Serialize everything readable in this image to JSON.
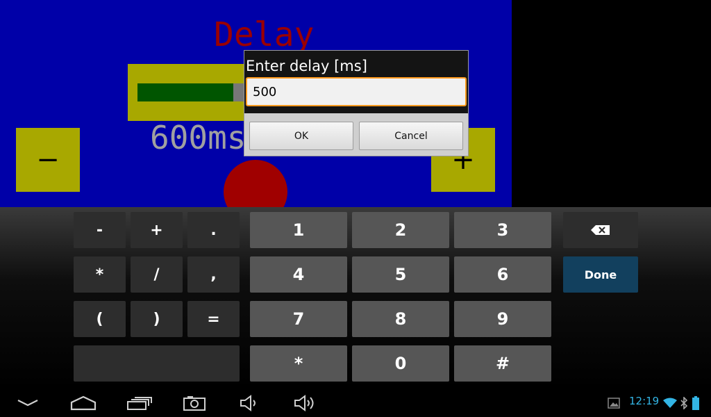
{
  "app": {
    "title": "Delay",
    "value_label": "600ms",
    "minus_label": "−",
    "plus_label": "+",
    "slider_fraction": 0.69
  },
  "dialog": {
    "title": "Enter delay [ms]",
    "input_value": "500",
    "ok_label": "OK",
    "cancel_label": "Cancel"
  },
  "keyboard": {
    "symbol_keys": [
      "-",
      "+",
      ".",
      "*",
      "/",
      ",",
      "(",
      ")",
      "="
    ],
    "number_keys": [
      "1",
      "2",
      "3",
      "4",
      "5",
      "6",
      "7",
      "8",
      "9",
      "*",
      "0",
      "#"
    ],
    "done_label": "Done"
  },
  "status_bar": {
    "time": "12:19"
  },
  "icons": {
    "nav": [
      "hide-keyboard-icon",
      "home-icon",
      "recent-apps-icon",
      "camera-icon",
      "volume-down-icon",
      "volume-up-icon"
    ],
    "status": [
      "gallery-notification-icon",
      "wifi-icon",
      "bluetooth-icon",
      "battery-icon"
    ]
  },
  "colors": {
    "app_background": "#0000a8",
    "title": "#9a0000",
    "button_yellow": "#a8a800",
    "slider_fill": "#005500",
    "input_focus_border": "#ff9a1e",
    "done_key": "#12405e",
    "clock": "#33b5e5"
  }
}
